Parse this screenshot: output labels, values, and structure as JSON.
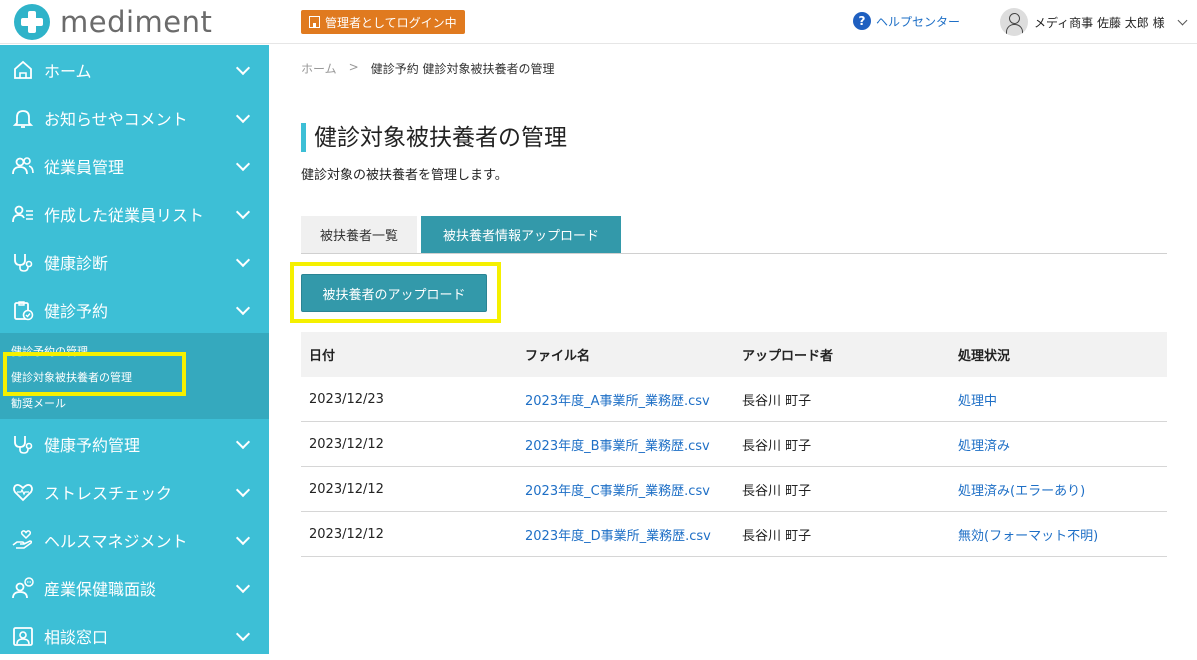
{
  "header": {
    "logo_text": "mediment",
    "admin_badge": "管理者としてログイン中",
    "help_label": "ヘルプセンター",
    "user_name": "メディ商事 佐藤 太郎 様"
  },
  "sidebar": {
    "items": [
      {
        "label": "ホーム",
        "icon": "home-icon"
      },
      {
        "label": "お知らせやコメント",
        "icon": "bell-icon"
      },
      {
        "label": "従業員管理",
        "icon": "users-icon"
      },
      {
        "label": "作成した従業員リスト",
        "icon": "user-list-icon"
      },
      {
        "label": "健康診断",
        "icon": "stethoscope-icon"
      },
      {
        "label": "健診予約",
        "icon": "clipboard-check-icon"
      },
      {
        "label": "健康予約管理",
        "icon": "stethoscope-icon"
      },
      {
        "label": "ストレスチェック",
        "icon": "heart-icon"
      },
      {
        "label": "ヘルスマネジメント",
        "icon": "hand-heart-icon"
      },
      {
        "label": "産業保健職面談",
        "icon": "chat-person-icon"
      },
      {
        "label": "相談窓口",
        "icon": "contact-card-icon"
      }
    ],
    "submenu": [
      "健診予約の管理",
      "健診対象被扶養者の管理",
      "勧奨メール"
    ]
  },
  "breadcrumb": {
    "home": "ホーム",
    "separator": ">",
    "current": "健診予約 健診対象被扶養者の管理"
  },
  "page": {
    "title": "健診対象被扶養者の管理",
    "description": "健診対象の被扶養者を管理します。"
  },
  "tabs": [
    "被扶養者一覧",
    "被扶養者情報アップロード"
  ],
  "upload_button": "被扶養者のアップロード",
  "table": {
    "headers": [
      "日付",
      "ファイル名",
      "アップロード者",
      "処理状況"
    ],
    "rows": [
      [
        "2023/12/23",
        "2023年度_A事業所_業務歴.csv",
        "長谷川 町子",
        "処理中"
      ],
      [
        "2023/12/12",
        "2023年度_B事業所_業務歴.csv",
        "長谷川 町子",
        "処理済み"
      ],
      [
        "2023/12/12",
        "2023年度_C事業所_業務歴.csv",
        "長谷川 町子",
        "処理済み(エラーあり)"
      ],
      [
        "2023/12/12",
        "2023年度_D事業所_業務歴.csv",
        "長谷川 町子",
        "無効(フォーマット不明)"
      ]
    ]
  },
  "colors": {
    "sidebar": "#3dbfd6",
    "submenu": "#35a9be",
    "primary_button": "#3399aa",
    "admin_badge": "#e07a1f",
    "link": "#1e6fc6",
    "highlight": "#f5f000"
  }
}
